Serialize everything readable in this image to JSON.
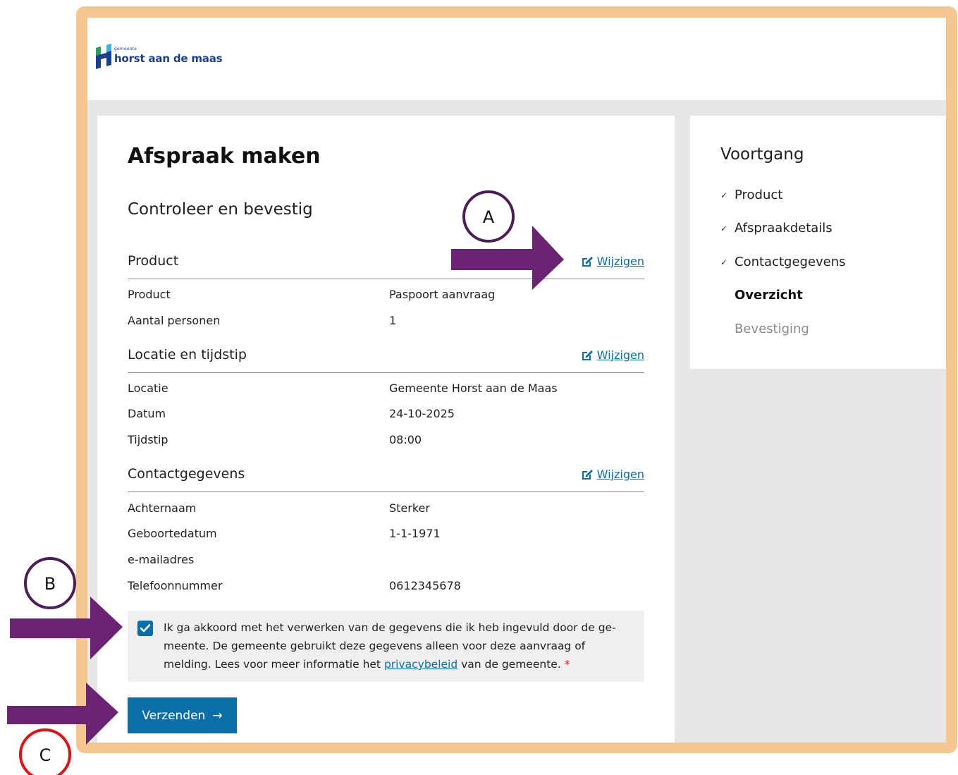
{
  "logo": {
    "small_text": "gemeente",
    "name": "horst aan de maas"
  },
  "page": {
    "title": "Afspraak maken",
    "subtitle": "Controleer en bevestig"
  },
  "edit_label": "Wijzigen",
  "sections": {
    "product": {
      "title": "Product",
      "rows": [
        {
          "label": "Product",
          "value": "Paspoort aanvraag"
        },
        {
          "label": "Aantal personen",
          "value": "1"
        }
      ]
    },
    "location": {
      "title": "Locatie en tijdstip",
      "rows": [
        {
          "label": "Locatie",
          "value": "Gemeente Horst aan de Maas"
        },
        {
          "label": "Datum",
          "value": "24-10-2025"
        },
        {
          "label": "Tijdstip",
          "value": "08:00"
        }
      ]
    },
    "contact": {
      "title": "Contactgegevens",
      "rows": [
        {
          "label": "Achternaam",
          "value": "Sterker"
        },
        {
          "label": "Geboortedatum",
          "value": "1-1-1971"
        },
        {
          "label": "e-mailadres",
          "value": ""
        },
        {
          "label": "Telefoonnummer",
          "value": "0612345678"
        }
      ]
    }
  },
  "consent": {
    "checked": true,
    "text_before": "Ik ga akkoord met het verwerken van de gegevens die ik heb ingevuld door de ge-meente. De gemeente gebruikt deze gegevens alleen voor deze aanvraag of melding. Lees voor meer informatie het ",
    "link": "privacybeleid",
    "text_after": " van de gemeente.",
    "required_mark": "*"
  },
  "submit": {
    "label": "Verzenden",
    "arrow": "→"
  },
  "progress": {
    "title": "Voortgang",
    "check_glyph": "✓",
    "steps": [
      {
        "label": "Product",
        "state": "done"
      },
      {
        "label": "Afspraakdetails",
        "state": "done"
      },
      {
        "label": "Contactgegevens",
        "state": "done"
      },
      {
        "label": "Overzicht",
        "state": "current"
      },
      {
        "label": "Bevestiging",
        "state": "todo"
      }
    ]
  },
  "annotations": {
    "a": "A",
    "b": "B",
    "c": "C",
    "arrow_color": "#6b2374",
    "circle_color_ab": "#4a1f55",
    "circle_color_c": "#e01010"
  },
  "colors": {
    "frame": "#f4c690",
    "link": "#0b6ea8",
    "button": "#0b6ea8"
  }
}
